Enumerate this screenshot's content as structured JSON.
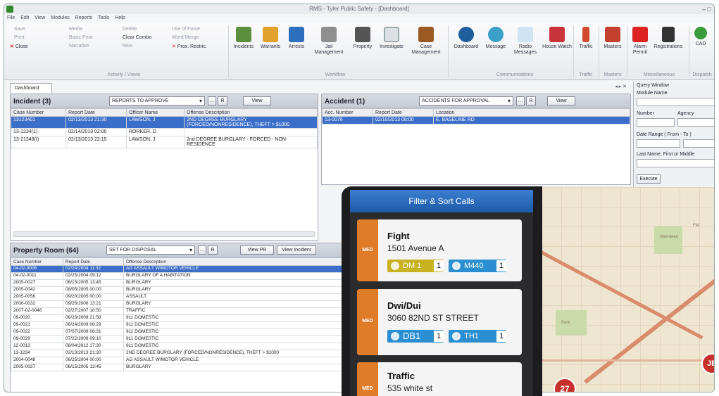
{
  "window": {
    "title": "RMS - Tyler Public Safety - [Dashboard]",
    "controls": "– □"
  },
  "menu": [
    "File",
    "Edit",
    "View",
    "Modules",
    "Reports",
    "Tools",
    "Help"
  ],
  "ribbon": {
    "small_left": [
      "Save",
      "Print",
      "Close"
    ],
    "small_mid": [
      "Media",
      "Basic Print",
      "Narrative"
    ],
    "small_mid2": [
      "Delete",
      "Clear Combo",
      "New"
    ],
    "small_mid3": [
      "Use of Force",
      "Word Merge",
      "Prox. Restric."
    ],
    "groups": [
      "Activity / Views",
      "Workflow",
      "Communications",
      "Traffic",
      "Masters",
      "Miscellaneous",
      "Dispatch"
    ],
    "buttons": [
      "Incidents",
      "Warrants",
      "Arrests",
      "Jail Management",
      "Property",
      "Investigate",
      "Case Management",
      "Dashboard",
      "Message",
      "Radio Messages",
      "House Watch",
      "Traffic",
      "Masters",
      "Alarm Permit",
      "Registrations",
      "CAD"
    ]
  },
  "doc_tab": "Dashboard",
  "incident": {
    "title": "Incident (3)",
    "filter": "REPORTS TO APPROVE",
    "r": "R",
    "view": "View",
    "headers": [
      "Case Number",
      "Report Date",
      "Officer Name",
      "Offense Description"
    ],
    "rows": [
      [
        "13123401",
        "02/13/2013 21:30",
        "LAWSON, J",
        "2ND DEGREE BURGLARY (FORCED/NONRESIDENCE), THEFT > $1000"
      ],
      [
        "13-1234(1)",
        "02/14/2013 02:00",
        "RORKER, D",
        ""
      ],
      [
        "13-21348(I)",
        "02/13/2013 22:15",
        "LAWSON, J",
        "2nd DEGREE BURGLARY - FORCED - NON-RESIDENCE"
      ]
    ]
  },
  "accident": {
    "title": "Accident (1)",
    "filter": "ACCIDENTS FOR APPROVAL",
    "r": "R",
    "view": "View",
    "headers": [
      "Acc. Number",
      "Report Date",
      "Location"
    ],
    "rows": [
      [
        "13-0076",
        "02/10/2013 08:00",
        "E. BASELINE RD"
      ]
    ]
  },
  "property": {
    "title": "Property Room (64)",
    "filter": "SET FOR DISPOSAL",
    "r": "R",
    "view_pr": "View PR",
    "view_incident": "View Incident",
    "headers": [
      "Case Number",
      "Report Date",
      "Offense Description"
    ],
    "rows": [
      [
        "04-02-0006",
        "02/24/2004 11:32",
        "AG ASSAULT W/MOTOR VEHICLE"
      ],
      [
        "04-02-0011",
        "02/25/2004 09:12",
        "BURGLARY OF A HABITATION"
      ],
      [
        "2005-0027",
        "06/15/2005 13:45",
        "BURGLARY"
      ],
      [
        "2005-0042",
        "08/05/2005 00:00",
        "BURGLARY"
      ],
      [
        "2005-0056",
        "09/20/2005 00:00",
        "ASSAULT"
      ],
      [
        "2006-0032",
        "09/26/2006 13:21",
        "BURGLARY"
      ],
      [
        "2007-02-0046",
        "02/27/2007 10:50",
        "TRAFFIC"
      ],
      [
        "09-0020",
        "06/23/2009 21:58",
        "911 DOMESTIC"
      ],
      [
        "09-0021",
        "06/24/2009 08:29",
        "911 DOMESTIC"
      ],
      [
        "09-0022",
        "07/07/2009 08:31",
        "911 DOMESTIC"
      ],
      [
        "09-0029",
        "07/22/2009 09:10",
        "911 DOMESTIC"
      ],
      [
        "12-0013",
        "08/04/2012 17:30",
        "911 DOMESTIC"
      ],
      [
        "13-1234",
        "02/13/2013 21:30",
        "2ND DEGREE BURGLARY (FORCED/NONRESIDENCE), THEFT > $1000"
      ],
      [
        "2004-0048",
        "06/25/2004 00:00",
        "AG ASSAULT W/MOTOR VEHICLE"
      ],
      [
        "2005-0027",
        "06/15/2005 13:45",
        "BURGLARY"
      ]
    ]
  },
  "query": {
    "title": "Query Window",
    "module": "Module Name",
    "number": "Number",
    "agency": "Agency",
    "date_range": "Date Range ( From - To )",
    "name": "Last Name, First or Middle",
    "execute": "Execute"
  },
  "mobile": {
    "header": "Filter & Sort Calls",
    "calls": [
      {
        "priority": "MED",
        "title": "Fight",
        "address": "1501 Avenue A",
        "units": [
          {
            "label": "DM 1",
            "count": "1",
            "color": "#c9b21f"
          },
          {
            "label": "M440",
            "count": "1",
            "color": "#2a8ed0"
          }
        ]
      },
      {
        "priority": "MED",
        "title": "Dwi/Dui",
        "address": "3060 82ND ST STREET",
        "units": [
          {
            "label": "DB1",
            "count": "1",
            "color": "#2a8ed0"
          },
          {
            "label": "TH1",
            "count": "1",
            "color": "#2a8ed0"
          }
        ]
      },
      {
        "priority": "MED",
        "title": "Traffic",
        "address": "535 white st",
        "units": []
      }
    ]
  },
  "map": {
    "badges": [
      "27",
      "JB"
    ],
    "labels": [
      "FM",
      "Aberdeen",
      "Park"
    ]
  }
}
